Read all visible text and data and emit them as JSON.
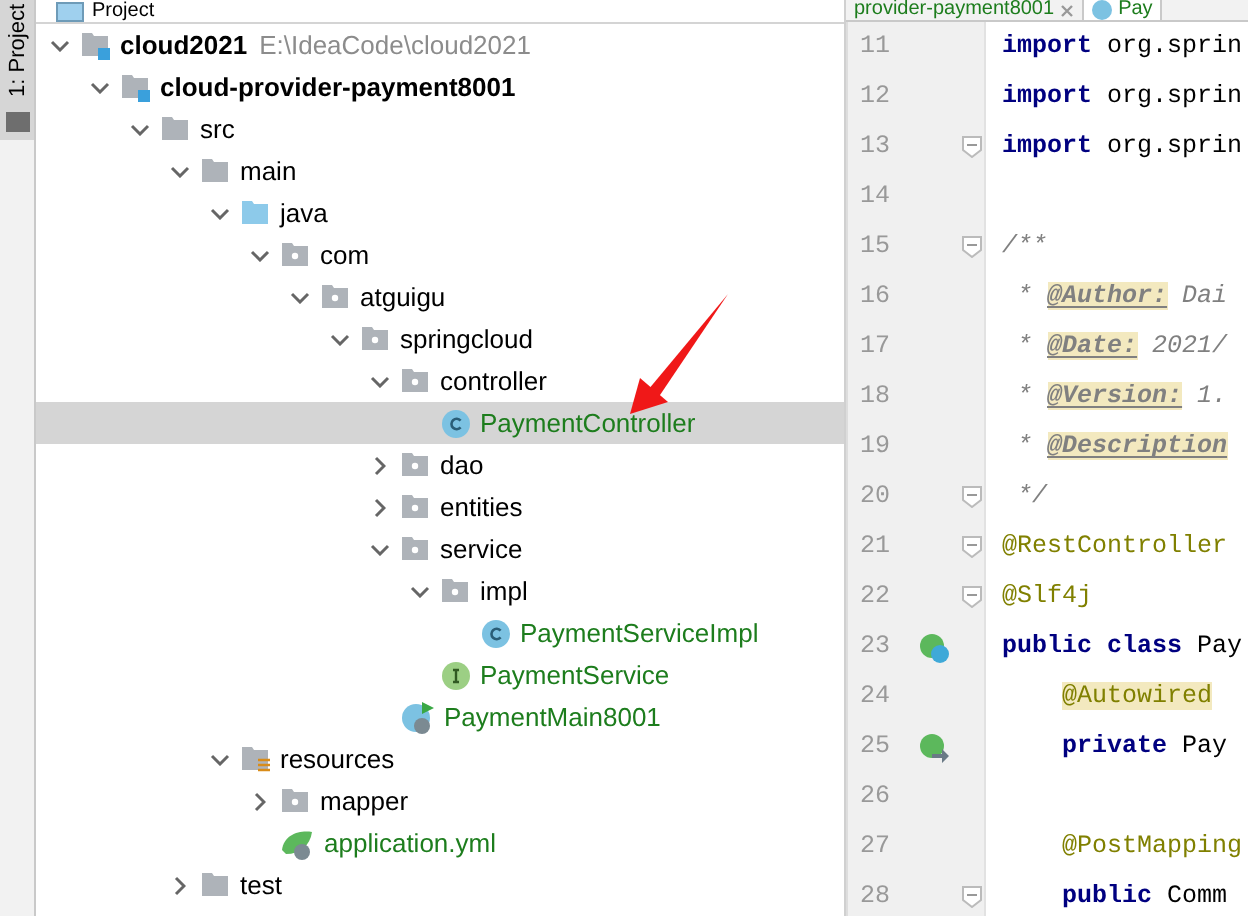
{
  "side_strip": {
    "tab_label": "1: Project",
    "selected": true
  },
  "project_panel": {
    "title": "Project",
    "tree": [
      {
        "label": "cloud2021",
        "path": "E:\\IdeaCode\\cloud2021",
        "kind": "module",
        "expanded": true,
        "selected": false,
        "added": false,
        "children": [
          {
            "label": "cloud-provider-payment8001",
            "kind": "module",
            "expanded": true,
            "selected": false,
            "added": false,
            "children": [
              {
                "label": "src",
                "kind": "folder",
                "expanded": true,
                "selected": false,
                "added": false,
                "children": [
                  {
                    "label": "main",
                    "kind": "folder",
                    "expanded": true,
                    "selected": false,
                    "added": false,
                    "children": [
                      {
                        "label": "java",
                        "kind": "source-root",
                        "expanded": true,
                        "selected": false,
                        "added": false,
                        "children": [
                          {
                            "label": "com",
                            "kind": "package",
                            "expanded": true,
                            "selected": false,
                            "added": false,
                            "children": [
                              {
                                "label": "atguigu",
                                "kind": "package",
                                "expanded": true,
                                "selected": false,
                                "added": false,
                                "children": [
                                  {
                                    "label": "springcloud",
                                    "kind": "package",
                                    "expanded": true,
                                    "selected": false,
                                    "added": false,
                                    "children": [
                                      {
                                        "label": "controller",
                                        "kind": "package",
                                        "expanded": true,
                                        "selected": false,
                                        "added": false,
                                        "children": [
                                          {
                                            "label": "PaymentController",
                                            "kind": "class",
                                            "selected": true,
                                            "added": true
                                          }
                                        ]
                                      },
                                      {
                                        "label": "dao",
                                        "kind": "package",
                                        "expanded": false,
                                        "selected": false,
                                        "added": false
                                      },
                                      {
                                        "label": "entities",
                                        "kind": "package",
                                        "expanded": false,
                                        "selected": false,
                                        "added": false
                                      },
                                      {
                                        "label": "service",
                                        "kind": "package",
                                        "expanded": true,
                                        "selected": false,
                                        "added": false,
                                        "children": [
                                          {
                                            "label": "impl",
                                            "kind": "package",
                                            "expanded": true,
                                            "selected": false,
                                            "added": false,
                                            "children": [
                                              {
                                                "label": "PaymentServiceImpl",
                                                "kind": "class",
                                                "selected": false,
                                                "added": true
                                              }
                                            ]
                                          },
                                          {
                                            "label": "PaymentService",
                                            "kind": "interface",
                                            "selected": false,
                                            "added": true
                                          }
                                        ]
                                      },
                                      {
                                        "label": "PaymentMain8001",
                                        "kind": "spring-main",
                                        "selected": false,
                                        "added": true
                                      }
                                    ]
                                  }
                                ]
                              }
                            ]
                          }
                        ]
                      },
                      {
                        "label": "resources",
                        "kind": "resources",
                        "expanded": true,
                        "selected": false,
                        "added": false,
                        "children": [
                          {
                            "label": "mapper",
                            "kind": "package",
                            "expanded": false,
                            "selected": false,
                            "added": false
                          },
                          {
                            "label": "application.yml",
                            "kind": "spring-config",
                            "selected": false,
                            "added": true
                          }
                        ]
                      }
                    ]
                  },
                  {
                    "label": "test",
                    "kind": "folder",
                    "expanded": false,
                    "selected": false,
                    "added": false
                  }
                ]
              }
            ]
          }
        ]
      }
    ]
  },
  "editor": {
    "tabs": [
      {
        "label": "provider-payment8001",
        "selected": false,
        "closable": true
      },
      {
        "label": "Pay",
        "selected": true,
        "closable": false
      }
    ],
    "lines": [
      {
        "number": "11",
        "fold": false,
        "indented": false,
        "tokens": [
          {
            "text": "import",
            "kind": "keyword"
          },
          {
            "text": " org.sprin",
            "kind": "plain"
          }
        ]
      },
      {
        "number": "12",
        "fold": false,
        "indented": false,
        "tokens": [
          {
            "text": "import",
            "kind": "keyword"
          },
          {
            "text": " org.sprin",
            "kind": "plain"
          }
        ]
      },
      {
        "number": "13",
        "fold": true,
        "indented": false,
        "tokens": [
          {
            "text": "import",
            "kind": "keyword"
          },
          {
            "text": " org.sprin",
            "kind": "plain"
          }
        ]
      },
      {
        "number": "14",
        "fold": false
      },
      {
        "number": "15",
        "fold": true,
        "indented": false,
        "tokens": [
          {
            "text": "/**",
            "kind": "comment"
          }
        ]
      },
      {
        "number": "16",
        "fold": false,
        "indented": false,
        "tokens": [
          {
            "text": " * ",
            "kind": "comment"
          },
          {
            "text": "@Author:",
            "kind": "doctag"
          },
          {
            "text": " Dai",
            "kind": "comment"
          }
        ]
      },
      {
        "number": "17",
        "fold": false,
        "indented": false,
        "tokens": [
          {
            "text": " * ",
            "kind": "comment"
          },
          {
            "text": "@Date:",
            "kind": "doctag"
          },
          {
            "text": " 2021/",
            "kind": "comment"
          }
        ]
      },
      {
        "number": "18",
        "fold": false,
        "indented": false,
        "tokens": [
          {
            "text": " * ",
            "kind": "comment"
          },
          {
            "text": "@Version:",
            "kind": "doctag"
          },
          {
            "text": " 1.",
            "kind": "comment"
          }
        ]
      },
      {
        "number": "19",
        "fold": false,
        "indented": false,
        "tokens": [
          {
            "text": " * ",
            "kind": "comment"
          },
          {
            "text": "@Description",
            "kind": "doctag"
          }
        ]
      },
      {
        "number": "20",
        "fold": true,
        "indented": false,
        "tokens": [
          {
            "text": " */",
            "kind": "comment"
          }
        ]
      },
      {
        "number": "21",
        "fold": true,
        "indented": false,
        "tokens": [
          {
            "text": "@RestController",
            "kind": "annotation"
          }
        ]
      },
      {
        "number": "22",
        "fold": true,
        "indented": false,
        "tokens": [
          {
            "text": "@Slf4j",
            "kind": "annotation"
          }
        ]
      },
      {
        "number": "23",
        "fold": false,
        "indented": false,
        "gutter_marks": [
          {
            "kind": "bean-class"
          }
        ],
        "tokens": [
          {
            "text": "public class",
            "kind": "keyword"
          },
          {
            "text": " Pay",
            "kind": "plain"
          }
        ]
      },
      {
        "number": "24",
        "fold": false,
        "indented": true,
        "tokens": [
          {
            "text": "@Autowired",
            "kind": "annotation-highlight"
          }
        ]
      },
      {
        "number": "25",
        "fold": false,
        "indented": true,
        "gutter_marks": [
          {
            "kind": "autowired"
          }
        ],
        "tokens": [
          {
            "text": "private",
            "kind": "keyword"
          },
          {
            "text": " Pay",
            "kind": "plain"
          }
        ]
      },
      {
        "number": "26",
        "fold": false
      },
      {
        "number": "27",
        "fold": false,
        "indented": true,
        "tokens": [
          {
            "text": "@PostMapping",
            "kind": "annotation"
          }
        ]
      },
      {
        "number": "28",
        "fold": true,
        "indented": true,
        "tokens": [
          {
            "text": "public",
            "kind": "keyword"
          },
          {
            "text": " Comm",
            "kind": "plain"
          }
        ]
      }
    ]
  }
}
